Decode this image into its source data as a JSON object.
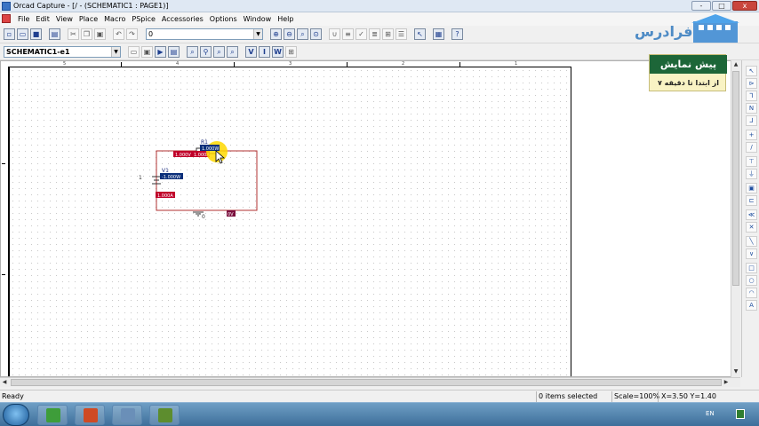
{
  "window": {
    "title": "Orcad Capture - [/ - (SCHEMATIC1 : PAGE1)]",
    "minimize_label": "-",
    "maximize_label": "□",
    "close_label": "x"
  },
  "menu": [
    "File",
    "Edit",
    "View",
    "Place",
    "Macro",
    "PSpice",
    "Accessories",
    "Options",
    "Window",
    "Help"
  ],
  "toolbar": {
    "part_combo_value": "0",
    "schematic_combo_value": "SCHEMATIC1-e1"
  },
  "ruler": {
    "labels": [
      "5",
      "4",
      "3",
      "2",
      "1"
    ]
  },
  "schematic": {
    "resistor": {
      "ref": "R1",
      "power": "1.000W",
      "voltage": "1.000V",
      "current": "1.000A"
    },
    "source": {
      "ref": "V1",
      "power": "-1.000W",
      "current": "1.000A",
      "node": "1"
    },
    "ground": {
      "label": "0",
      "voltage": "0V"
    }
  },
  "promo": {
    "logo_text": "فرادرس",
    "title": "پیش نمایش",
    "subtitle": "از ابتدا تا دقیقه ۷"
  },
  "status": {
    "state": "Ready",
    "selection": "0 items selected",
    "scale": "Scale=100%",
    "coords": "X=3.50  Y=1.40"
  },
  "tray": {
    "language": "EN"
  },
  "colors": {
    "wire": "#b03030",
    "voltage_label_bg": "#c0002a",
    "power_label_bg": "#0b2f7a",
    "cursor_highlight": "#ffd800",
    "promo_green": "#1d6638"
  },
  "icons": {
    "toolbar1": [
      "new-icon",
      "open-icon",
      "save-icon",
      "print-icon",
      "cut-icon",
      "copy-icon",
      "paste-icon",
      "undo-icon",
      "redo-icon",
      "zoom-in-icon",
      "zoom-out-icon",
      "zoom-area-icon",
      "zoom-all-icon",
      "annotate-icon",
      "back-annotate-icon",
      "drc-icon",
      "netlist-icon",
      "crossref-icon",
      "bom-icon",
      "snap-icon",
      "project-manager-icon",
      "help-icon"
    ],
    "toolbar2": [
      "new-simulation-icon",
      "edit-simulation-icon",
      "run-icon",
      "view-results-icon",
      "voltage-marker-icon",
      "current-marker-icon",
      "power-marker-icon",
      "voltage-display-icon",
      "current-display-icon",
      "power-display-icon"
    ],
    "right_palette": [
      "select-icon",
      "place-part-icon",
      "wire-icon",
      "net-alias-icon",
      "bus-icon",
      "junction-icon",
      "bus-entry-icon",
      "power-icon",
      "ground-icon",
      "hierarchical-block-icon",
      "port-icon",
      "off-page-connector-icon",
      "no-connect-icon",
      "line-icon",
      "polyline-icon",
      "rectangle-icon",
      "ellipse-icon",
      "arc-icon",
      "text-icon"
    ]
  }
}
